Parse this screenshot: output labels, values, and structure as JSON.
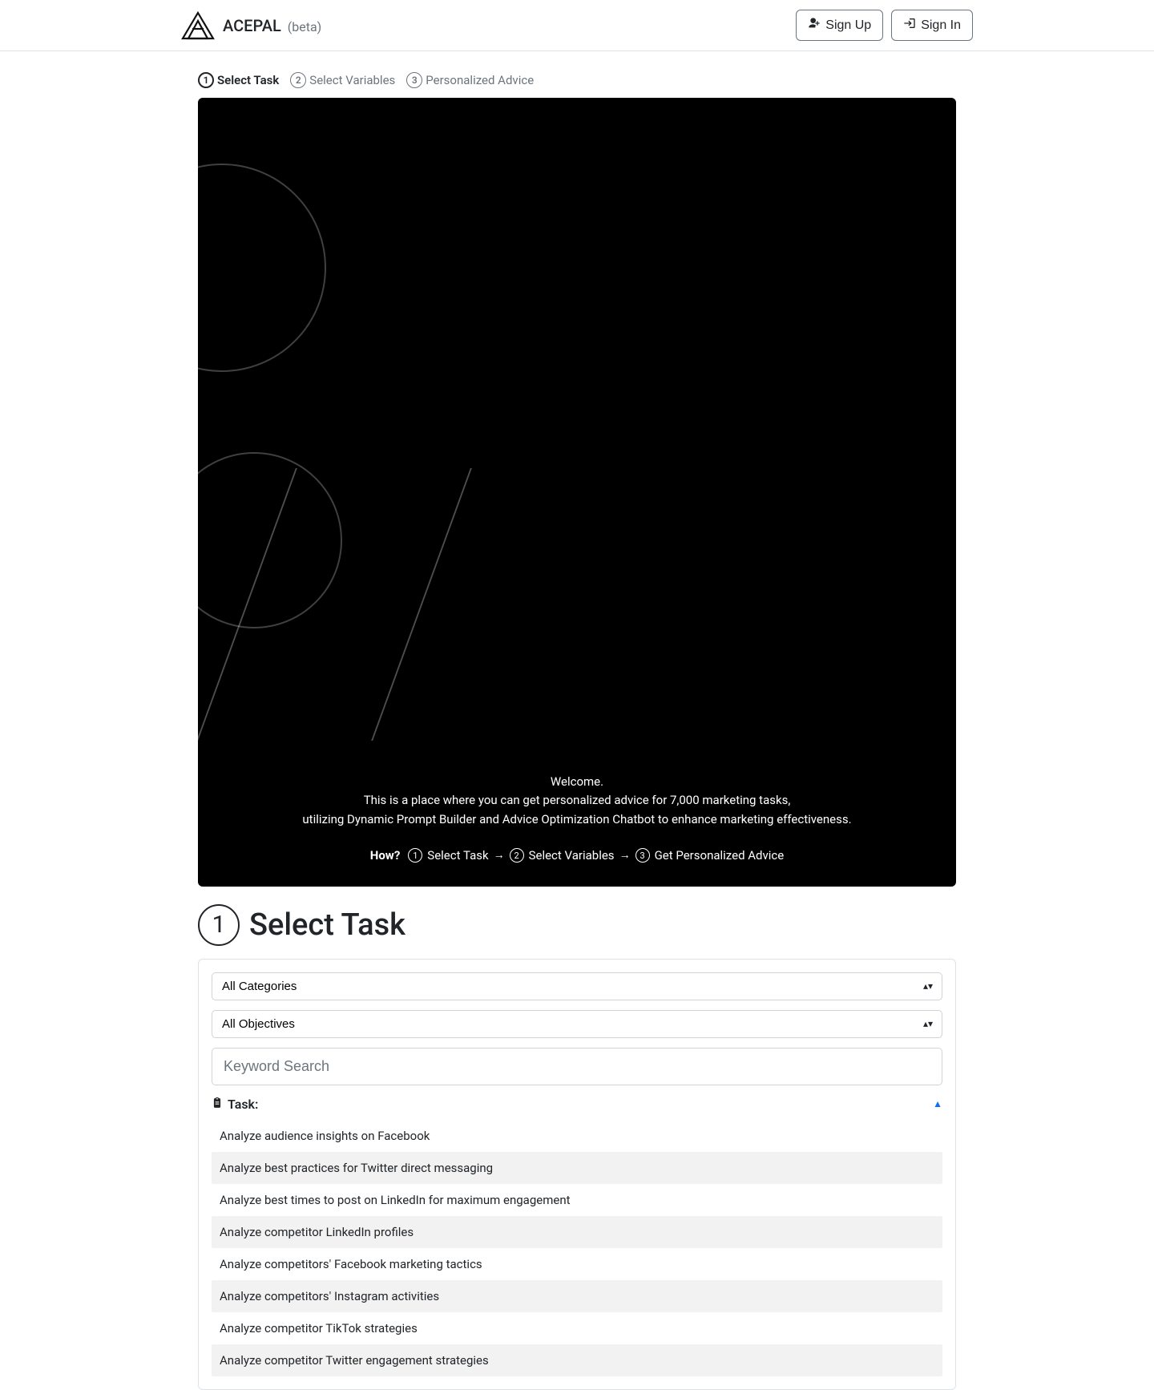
{
  "brand": {
    "name": "ACEPAL",
    "suffix": "(beta)"
  },
  "auth": {
    "signup_label": "Sign Up",
    "signin_label": "Sign In"
  },
  "stepper": {
    "step1": {
      "num": "1",
      "label": "Select Task"
    },
    "step2": {
      "num": "2",
      "label": "Select Variables"
    },
    "step3": {
      "num": "3",
      "label": "Personalized Advice"
    }
  },
  "hero": {
    "welcome": "Welcome.",
    "line2": "This is a place where you can get personalized advice for 7,000 marketing tasks,",
    "line3": "utilizing Dynamic Prompt Builder and Advice Optimization Chatbot to enhance marketing effectiveness.",
    "how_label": "How?",
    "how1_num": "1",
    "how1_text": "Select Task",
    "how2_num": "2",
    "how2_text": "Select Variables",
    "how3_num": "3",
    "how3_text": "Get Personalized Advice"
  },
  "section": {
    "num": "1",
    "title": "Select Task"
  },
  "filters": {
    "category_selected": "All Categories",
    "objective_selected": "All Objectives",
    "search_placeholder": "Keyword Search"
  },
  "task_table": {
    "header_label": "Task:",
    "items": [
      "Analyze audience insights on Facebook",
      "Analyze best practices for Twitter direct messaging",
      "Analyze best times to post on LinkedIn for maximum engagement",
      "Analyze competitor LinkedIn profiles",
      "Analyze competitors' Facebook marketing tactics",
      "Analyze competitors' Instagram activities",
      "Analyze competitor TikTok strategies",
      "Analyze competitor Twitter engagement strategies"
    ]
  }
}
